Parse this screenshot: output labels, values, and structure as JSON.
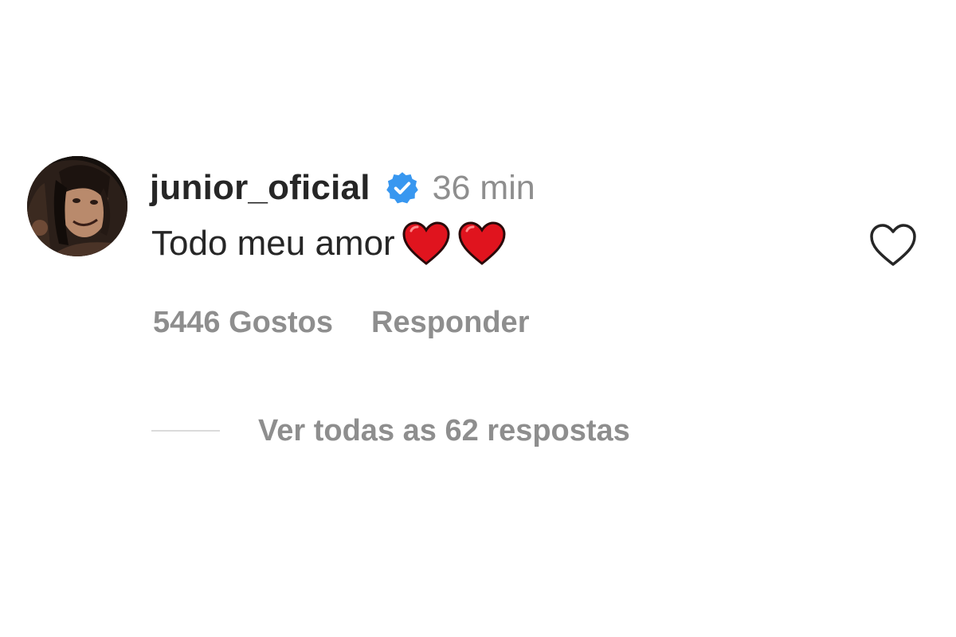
{
  "comment": {
    "username": "junior_oficial",
    "verified_icon": "verified-badge-icon",
    "time": "36 min",
    "text": "Todo meu amor",
    "emojis": [
      "red-heart-icon",
      "red-heart-icon"
    ],
    "likes": "5446 Gostos",
    "reply_label": "Responder",
    "view_replies_label": "Ver todas as 62 respostas",
    "like_icon": "heart-outline-icon"
  },
  "colors": {
    "primary_text": "#262626",
    "secondary_text": "#8e8e8e",
    "verified_blue": "#3897f0",
    "heart_red": "#e0141e",
    "divider": "#dbdbdb",
    "background": "#ffffff"
  }
}
